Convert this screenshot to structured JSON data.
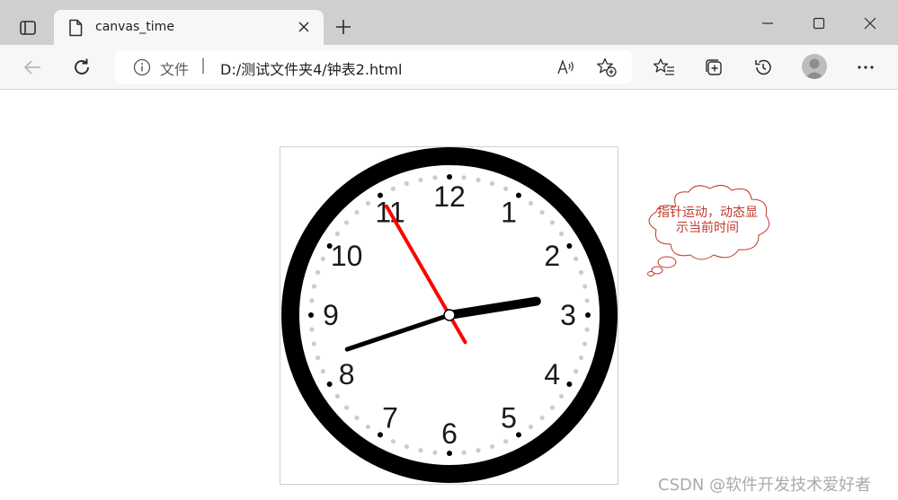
{
  "browser": {
    "tab": {
      "title": "canvas_time"
    },
    "address": {
      "security_label": "文件",
      "separator": "|",
      "url": "D:/测试文件夹4/钟表2.html"
    },
    "toolbar_icons": [
      "back-icon",
      "refresh-icon",
      "info-icon",
      "read-aloud-icon",
      "add-favorite-icon",
      "favorites-icon",
      "collections-icon",
      "history-icon",
      "profile-icon",
      "more-icon"
    ],
    "window_icons": [
      "minimize-icon",
      "maximize-icon",
      "close-icon"
    ],
    "colors": {
      "titlebar": "#cfcfcf",
      "toolbar": "#f7f7f7"
    }
  },
  "page": {
    "clock": {
      "numbers": [
        "12",
        "1",
        "2",
        "3",
        "4",
        "5",
        "6",
        "7",
        "8",
        "9",
        "10",
        "11"
      ],
      "time": {
        "hour": 2,
        "minute": 41,
        "second": 55
      },
      "colors": {
        "rim": "#000000",
        "second_hand": "#ff0000",
        "hand": "#000000",
        "minute_dots": "#cccccc",
        "hour_dots": "#000000",
        "pin": "#ffffff"
      }
    },
    "bubble": {
      "text": "指针运动，动态显示当前时间",
      "color": "#c0392b"
    },
    "watermark": "CSDN @软件开发技术爱好者"
  }
}
